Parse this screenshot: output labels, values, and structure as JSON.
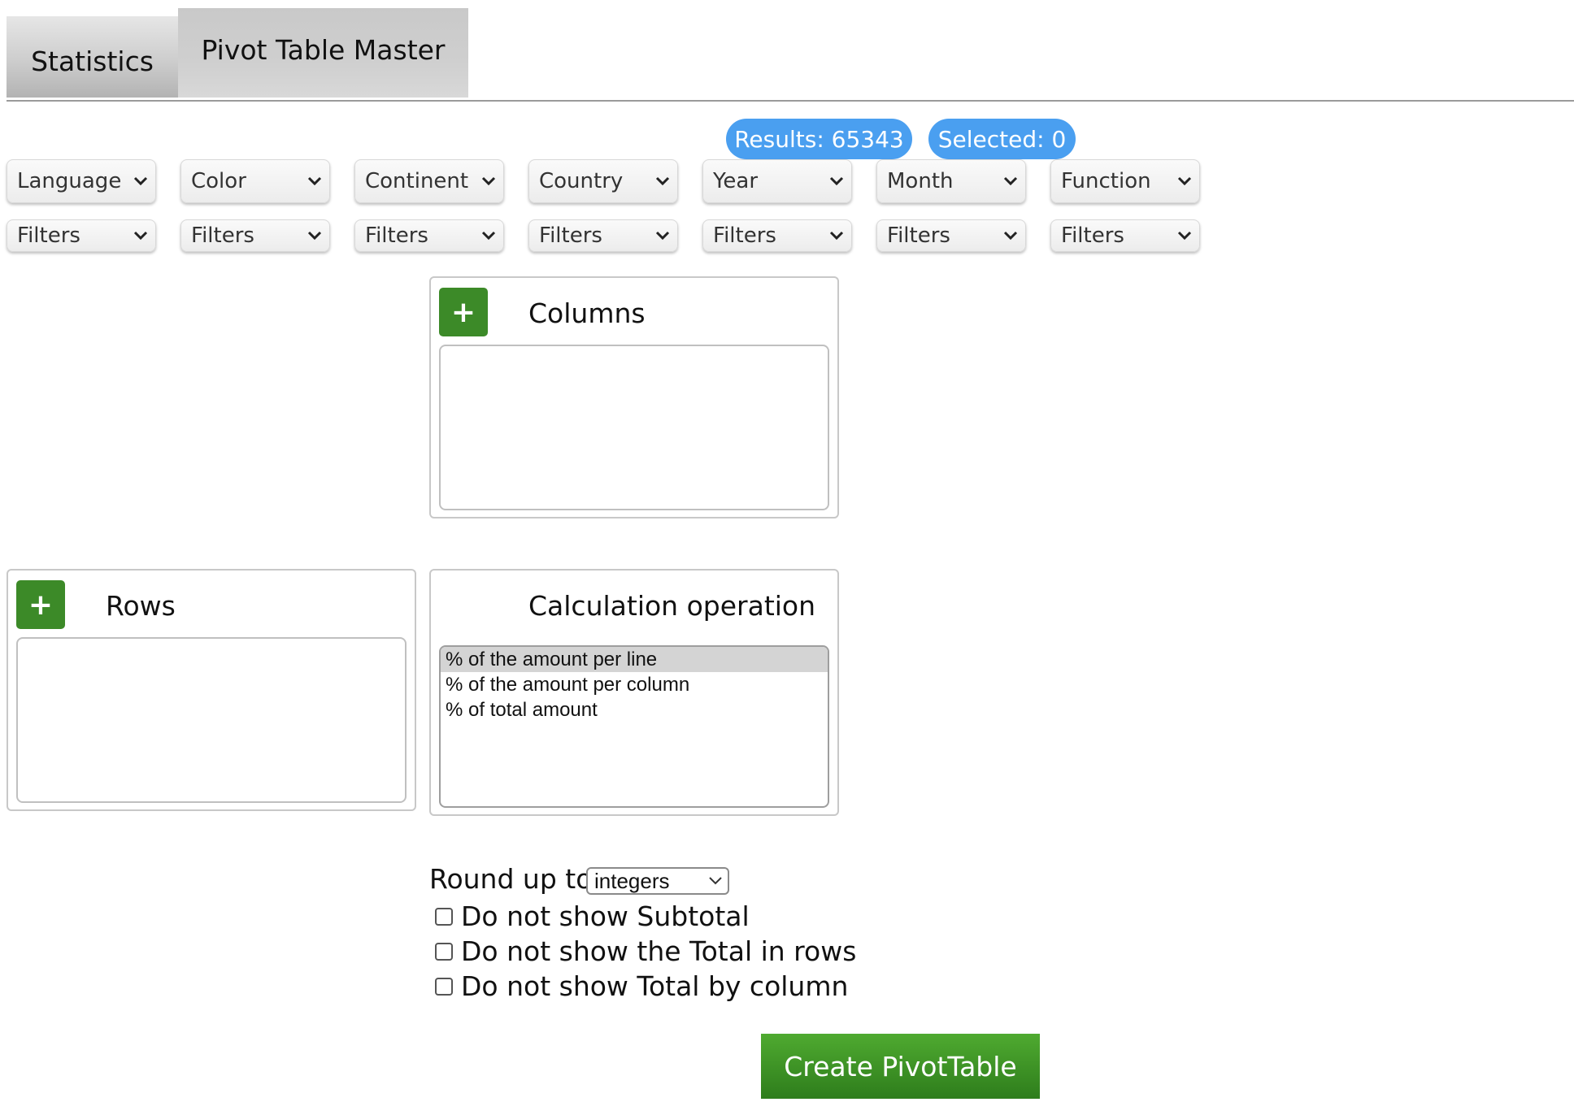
{
  "tabs": {
    "statistics": "Statistics",
    "pivot": "Pivot Table Master"
  },
  "badges": {
    "results": "Results: 65343",
    "selected": "Selected: 0"
  },
  "fields": [
    "Language",
    "Color",
    "Continent",
    "Country",
    "Year",
    "Month",
    "Function"
  ],
  "filter_label": "Filters",
  "columns_panel": {
    "title": "Columns",
    "add_label": "+"
  },
  "rows_panel": {
    "title": "Rows",
    "add_label": "+"
  },
  "calculation": {
    "title": "Calculation operation",
    "options": [
      "% of the amount per line",
      "% of the amount per column",
      "% of total amount"
    ],
    "selected": "% of the amount per line"
  },
  "round": {
    "label": "Round up to",
    "value": "integers"
  },
  "checkboxes": [
    {
      "label": "Do not show Subtotal",
      "checked": false
    },
    {
      "label": "Do not show the Total in rows",
      "checked": false
    },
    {
      "label": "Do not show Total by column",
      "checked": false
    }
  ],
  "create_button": "Create PivotTable",
  "colors": {
    "badge": "#4a9ff0",
    "add_button": "#3c8a28",
    "create_button": "#3a8f24"
  }
}
